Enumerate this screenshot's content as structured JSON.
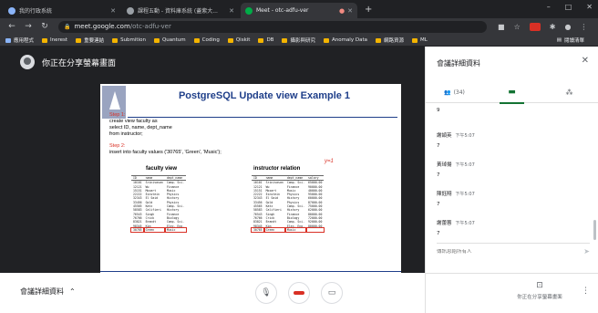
{
  "browser": {
    "tabs": [
      {
        "title": "我的行政系統",
        "fav_color": "#8ab4f8",
        "active": false
      },
      {
        "title": "課程五動 - 資料庫系統 (蓋紫大...",
        "fav_color": "#9aa0a6",
        "active": false
      },
      {
        "title": "Meet - otc-adfu-ver",
        "fav_color": "#00ac47",
        "active": true
      }
    ],
    "new_tab": "+",
    "window_controls": [
      "–",
      "□",
      "✕"
    ],
    "url_host": "meet.google.com",
    "url_path": "/otc-adfu-ver",
    "bookmarks": [
      "應用程式",
      "Inerest",
      "重要連結",
      "Submition",
      "Quantum",
      "Coding",
      "Qiskit",
      "DB",
      "攝影與研究",
      "Anomaly Data",
      "網路資源",
      "ML"
    ],
    "reading_list": "閱讀清單"
  },
  "meet": {
    "presenting_label": "你正在分享螢幕畫面",
    "meeting_details_label": "會議詳細資料",
    "present_now_label": "你正在分享螢幕畫面"
  },
  "slide": {
    "title": "PostgreSQL Update view Example 1",
    "step1_label": "Step 1:",
    "step1_lines": [
      "create view faculty as",
      "select ID, name, dept_name",
      "from instructor;"
    ],
    "step2_label": "Step 2:",
    "step2_line": "insert into faculty values ('30765', 'Green', 'Music');",
    "annotation": "y=1",
    "left_table_title": "faculty view",
    "right_table_title": "instructor relation",
    "left_header": [
      "ID",
      "name",
      "dept_name"
    ],
    "right_header": [
      "ID",
      "name",
      "dept_name",
      "salary"
    ],
    "left_rows": [
      [
        "10101",
        "Srinivasan",
        "Comp. Sci."
      ],
      [
        "12121",
        "Wu",
        "Finance"
      ],
      [
        "15151",
        "Mozart",
        "Music"
      ],
      [
        "22222",
        "Einstein",
        "Physics"
      ],
      [
        "32343",
        "El Said",
        "History"
      ],
      [
        "33456",
        "Gold",
        "Physics"
      ],
      [
        "45565",
        "Katz",
        "Comp. Sci."
      ],
      [
        "58583",
        "Califieri",
        "History"
      ],
      [
        "76543",
        "Singh",
        "Finance"
      ],
      [
        "76766",
        "Crick",
        "Biology"
      ],
      [
        "83821",
        "Brandt",
        "Comp. Sci."
      ],
      [
        "98345",
        "Kim",
        "Elec. Eng."
      ],
      [
        "30765",
        "Green",
        "Music"
      ]
    ],
    "right_rows": [
      [
        "10101",
        "Srinivasan",
        "Comp. Sci.",
        "65000.00"
      ],
      [
        "12121",
        "Wu",
        "Finance",
        "90000.00"
      ],
      [
        "15151",
        "Mozart",
        "Music",
        "40000.00"
      ],
      [
        "22222",
        "Einstein",
        "Physics",
        "95000.00"
      ],
      [
        "32343",
        "El Said",
        "History",
        "60000.00"
      ],
      [
        "33456",
        "Gold",
        "Physics",
        "87000.00"
      ],
      [
        "45565",
        "Katz",
        "Comp. Sci.",
        "75000.00"
      ],
      [
        "58583",
        "Califieri",
        "History",
        "62000.00"
      ],
      [
        "76543",
        "Singh",
        "Finance",
        "80000.00"
      ],
      [
        "76766",
        "Crick",
        "Biology",
        "72000.00"
      ],
      [
        "83821",
        "Brandt",
        "Comp. Sci.",
        "92000.00"
      ],
      [
        "98345",
        "Kim",
        "Elec. Eng.",
        "80000.00"
      ],
      [
        "30765",
        "Green",
        "Music",
        ""
      ]
    ],
    "footer_left": "Database System Concepts - 7th Edition",
    "footer_mid": "36",
    "footer_right": "Quantum Information & Computation Lab @ NTTU"
  },
  "panel": {
    "title": "會議詳細資料",
    "people_count": "(34)",
    "messages": [
      {
        "who": "",
        "time": "",
        "body": "9"
      },
      {
        "who": "謝頡英",
        "time": "下午5:07",
        "body": "7"
      },
      {
        "who": "黃琸揚",
        "time": "下午5:07",
        "body": "7"
      },
      {
        "who": "陳鈺翔",
        "time": "下午5:07",
        "body": "7"
      },
      {
        "who": "謝蕾蓉",
        "time": "下午5:07",
        "body": "7"
      }
    ],
    "input_placeholder": "傳訊息給所有人"
  }
}
